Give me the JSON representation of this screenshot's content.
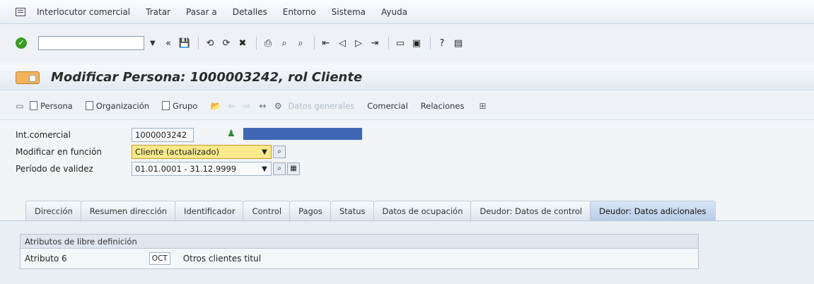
{
  "menu": {
    "items": [
      "Interlocutor comercial",
      "Tratar",
      "Pasar a",
      "Detalles",
      "Entorno",
      "Sistema",
      "Ayuda"
    ]
  },
  "toolbar": {
    "command_value": "",
    "back_label": "«"
  },
  "title": {
    "text": "Modificar Persona: 1000003242, rol Cliente"
  },
  "app_toolbar": {
    "buttons": [
      "Persona",
      "Organización",
      "Grupo"
    ],
    "disabled_label": "Datos generales",
    "comercial": "Comercial",
    "relaciones": "Relaciones"
  },
  "form": {
    "int_comercial_label": "Int.comercial",
    "int_comercial_value": "1000003242",
    "modificar_label": "Modificar en función",
    "modificar_value": "Cliente (actualizado)",
    "periodo_label": "Período de validez",
    "periodo_value": "01.01.0001 - 31.12.9999"
  },
  "tabs": [
    {
      "label": "Dirección"
    },
    {
      "label": "Resumen dirección"
    },
    {
      "label": "Identificador"
    },
    {
      "label": "Control"
    },
    {
      "label": "Pagos"
    },
    {
      "label": "Status"
    },
    {
      "label": "Datos de ocupación"
    },
    {
      "label": "Deudor: Datos de control"
    },
    {
      "label": "Deudor: Datos adicionales"
    }
  ],
  "panel": {
    "group_title": "Atributos de libre definición",
    "attr_label": "Atributo 6",
    "attr_code": "OCT",
    "attr_desc": "Otros clientes titul"
  },
  "colors": {
    "highlight": "#f8e98a",
    "blue_strip": "#3f67b3"
  }
}
